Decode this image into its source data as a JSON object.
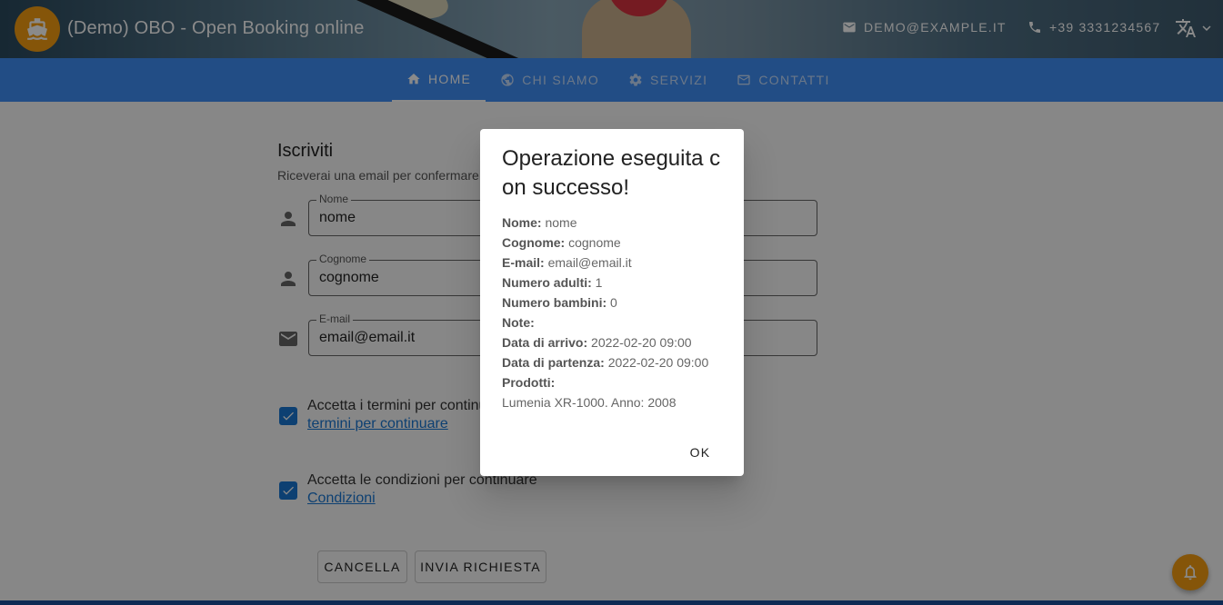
{
  "header": {
    "app_title": "(Demo) OBO - Open Booking online",
    "email": "DEMO@EXAMPLE.IT",
    "phone": "+39 3331234567",
    "brand_color": "#f59d12"
  },
  "nav": {
    "tabs": [
      {
        "label": "HOME",
        "icon": "home-icon",
        "active": true
      },
      {
        "label": "CHI SIAMO",
        "icon": "globe-icon",
        "active": false
      },
      {
        "label": "SERVIZI",
        "icon": "gear-icon",
        "active": false
      },
      {
        "label": "CONTATTI",
        "icon": "mail-icon",
        "active": false
      }
    ],
    "color": "#3f8ef5"
  },
  "form": {
    "title": "Iscriviti",
    "subtitle": "Riceverai una email per confermare",
    "fields": [
      {
        "label": "Nome",
        "value": "nome",
        "icon": "person-icon"
      },
      {
        "label": "Cognome",
        "value": "cognome",
        "icon": "person-icon"
      },
      {
        "label": "E-mail",
        "value": "email@email.it",
        "icon": "mail-icon"
      }
    ],
    "checks": [
      {
        "text": "Accetta i termini per continuare",
        "link": "termini per continuare",
        "checked": true
      },
      {
        "text": "Accetta le condizioni per continuare",
        "link": "Condizioni",
        "checked": true
      }
    ],
    "cancel_label": "CANCELLA",
    "submit_label": "INVIA RICHIESTA"
  },
  "dialog": {
    "title": "Operazione eseguita con successo!",
    "rows": [
      {
        "key": "Nome:",
        "value": "nome"
      },
      {
        "key": "Cognome:",
        "value": "cognome"
      },
      {
        "key": "E-mail:",
        "value": "email@email.it"
      },
      {
        "key": "Numero adulti:",
        "value": "1"
      },
      {
        "key": "Numero bambini:",
        "value": "0"
      },
      {
        "key": "Note:",
        "value": ""
      },
      {
        "key": "Data di arrivo:",
        "value": "2022-02-20 09:00"
      },
      {
        "key": "Data di partenza:",
        "value": "2022-02-20 09:00"
      },
      {
        "key": "Prodotti:",
        "value": ""
      }
    ],
    "product_line": "Lumenia XR-1000. Anno: 2008",
    "ok_label": "OK"
  }
}
